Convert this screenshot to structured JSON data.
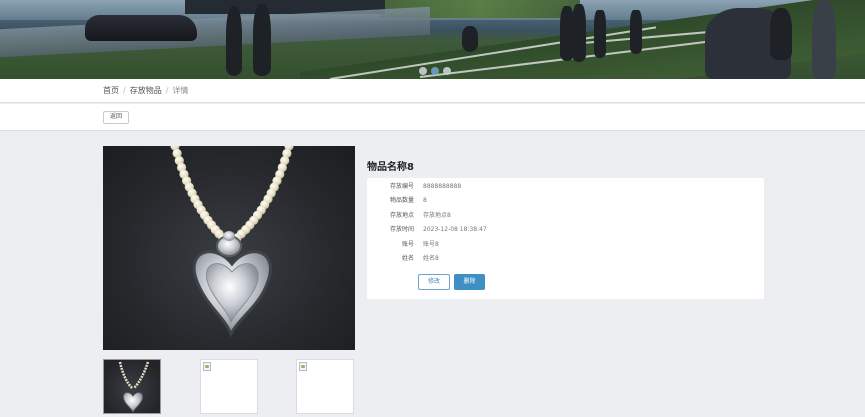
{
  "banner": {
    "carousel_dots": [
      {
        "active": false
      },
      {
        "active": true
      },
      {
        "active": false
      }
    ]
  },
  "breadcrumb": {
    "items": [
      "首页",
      "存放物品",
      "详情"
    ],
    "separator": "/"
  },
  "toolbar": {
    "back_label": "返回"
  },
  "item": {
    "title": "物品名称8",
    "fields": [
      {
        "label": "存放编号",
        "value": "8888888888"
      },
      {
        "label": "物品数量",
        "value": "8"
      },
      {
        "label": "存放地点",
        "value": "存放地点8"
      },
      {
        "label": "存放时间",
        "value": "2023-12-08 18:38:47"
      },
      {
        "label": "账号",
        "value": "账号8"
      },
      {
        "label": "姓名",
        "value": "姓名8"
      }
    ],
    "actions": {
      "edit_label": "修改",
      "delete_label": "删除"
    }
  },
  "colors": {
    "accent": "#3d8fc4",
    "edit_border": "#6aa3cc",
    "page_bg": "#eceef1"
  },
  "icons": {
    "main_image": "pearl-heart-locket-necklace",
    "thumbnails": [
      "pearl-heart-locket-necklace",
      "broken-image-icon",
      "broken-image-icon"
    ]
  }
}
